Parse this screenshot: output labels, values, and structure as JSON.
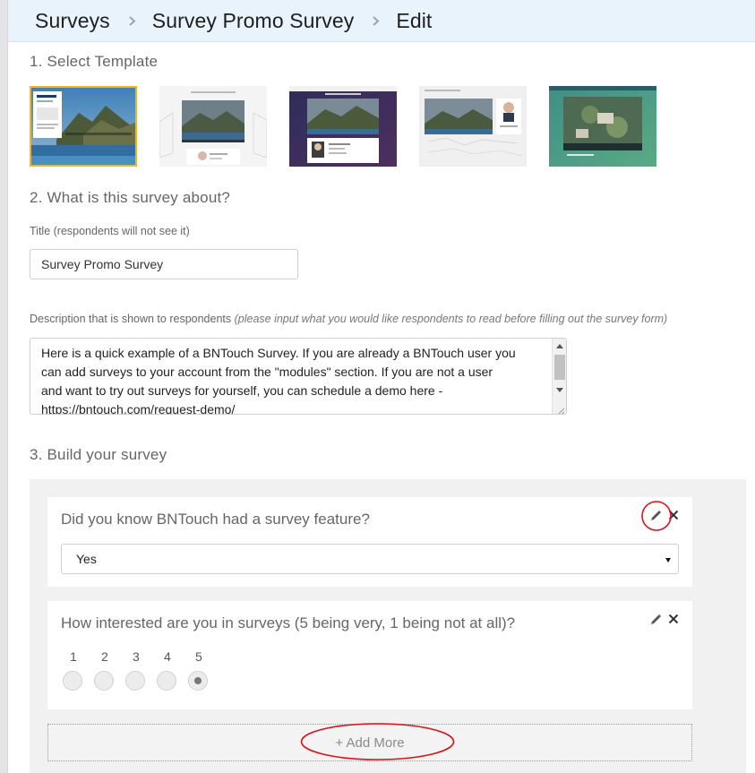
{
  "breadcrumb": {
    "items": [
      "Surveys",
      "Survey Promo Survey",
      "Edit"
    ]
  },
  "section1": {
    "title": "1. Select Template"
  },
  "templates": [
    {
      "name": "template-1",
      "logo": "SOTHEBY'S",
      "selected": true
    },
    {
      "name": "template-2",
      "selected": false
    },
    {
      "name": "template-3",
      "selected": false
    },
    {
      "name": "template-4",
      "selected": false
    },
    {
      "name": "template-5",
      "selected": false
    }
  ],
  "section2": {
    "title": "2. What is this survey about?",
    "title_label": "Title (respondents will not see it)",
    "title_value": "Survey Promo Survey",
    "desc_label": "Description that is shown to respondents",
    "desc_hint": "(please input what you would like respondents to read before filling out the survey form)",
    "desc_lines": [
      "Here is a quick example of a BNTouch Survey. If you are already a BNTouch user you",
      "can add surveys to your account from the \"modules\" section. If you are not a user",
      "and want to try out surveys for yourself, you can schedule a demo here -",
      "https://bntouch.com/request-demo/"
    ]
  },
  "section3": {
    "title": "3. Build your survey"
  },
  "questions": [
    {
      "text": "Did you know BNTouch had a survey feature?",
      "answer": "Yes"
    },
    {
      "text": "How interested are you in surveys (5 being very, 1 being not at all)?",
      "scale": [
        "1",
        "2",
        "3",
        "4",
        "5"
      ],
      "selected": "5"
    }
  ],
  "add_more": {
    "label": "+ Add More"
  },
  "colors": {
    "header_bg": "#e8f3fc",
    "selected_outline": "#f0b429",
    "annotation": "#d4141b"
  }
}
